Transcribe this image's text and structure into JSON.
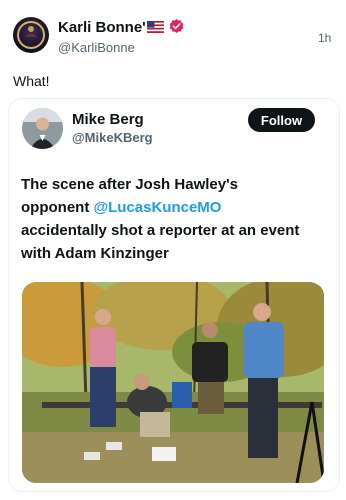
{
  "post": {
    "author_name": "Karli Bonne'",
    "author_handle": "@KarliBonne",
    "timestamp": "1h",
    "text": "What!",
    "avatar_icon": "brand-avatar-icon",
    "flag_icon": "us-flag-icon",
    "verified_icon": "verified-badge-icon",
    "verified_color": "#e0245e"
  },
  "quoted": {
    "author_name": "Mike Berg",
    "author_handle": "@MikeKBerg",
    "follow_label": "Follow",
    "text_before": "The scene after Josh Hawley's opponent ",
    "mention": "@LucasKunceMO",
    "text_after": " accidentally shot a reporter at an event with Adam Kinzinger",
    "link_color": "#1d9bf0"
  }
}
